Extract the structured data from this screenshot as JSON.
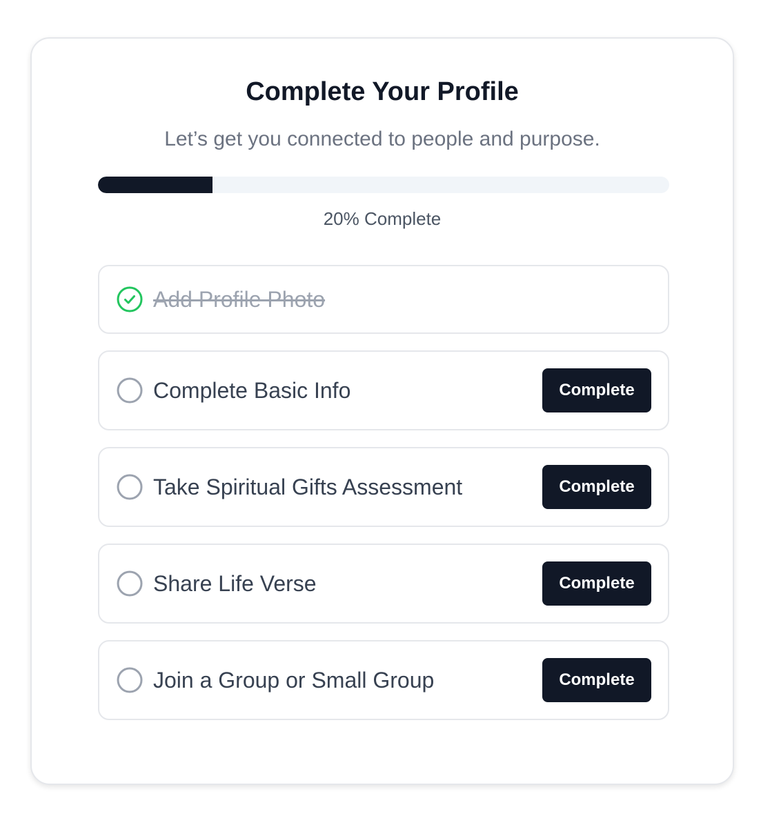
{
  "header": {
    "title": "Complete Your Profile",
    "subtitle": "Let’s get you connected to people and purpose."
  },
  "progress": {
    "percent": 20,
    "label": "20% Complete"
  },
  "tasks": [
    {
      "label": "Add Profile Photo",
      "completed": true,
      "icon": "check-circle-icon"
    },
    {
      "label": "Complete Basic Info",
      "completed": false,
      "icon": "empty-circle-icon",
      "button_label": "Complete"
    },
    {
      "label": "Take Spiritual Gifts Assessment",
      "completed": false,
      "icon": "empty-circle-icon",
      "button_label": "Complete"
    },
    {
      "label": "Share Life Verse",
      "completed": false,
      "icon": "empty-circle-icon",
      "button_label": "Complete"
    },
    {
      "label": "Join a Group or Small Group",
      "completed": false,
      "icon": "empty-circle-icon",
      "button_label": "Complete"
    }
  ],
  "colors": {
    "primary": "#111827",
    "success": "#22c55e",
    "muted": "#9ca3af",
    "track": "#f1f5f9"
  }
}
